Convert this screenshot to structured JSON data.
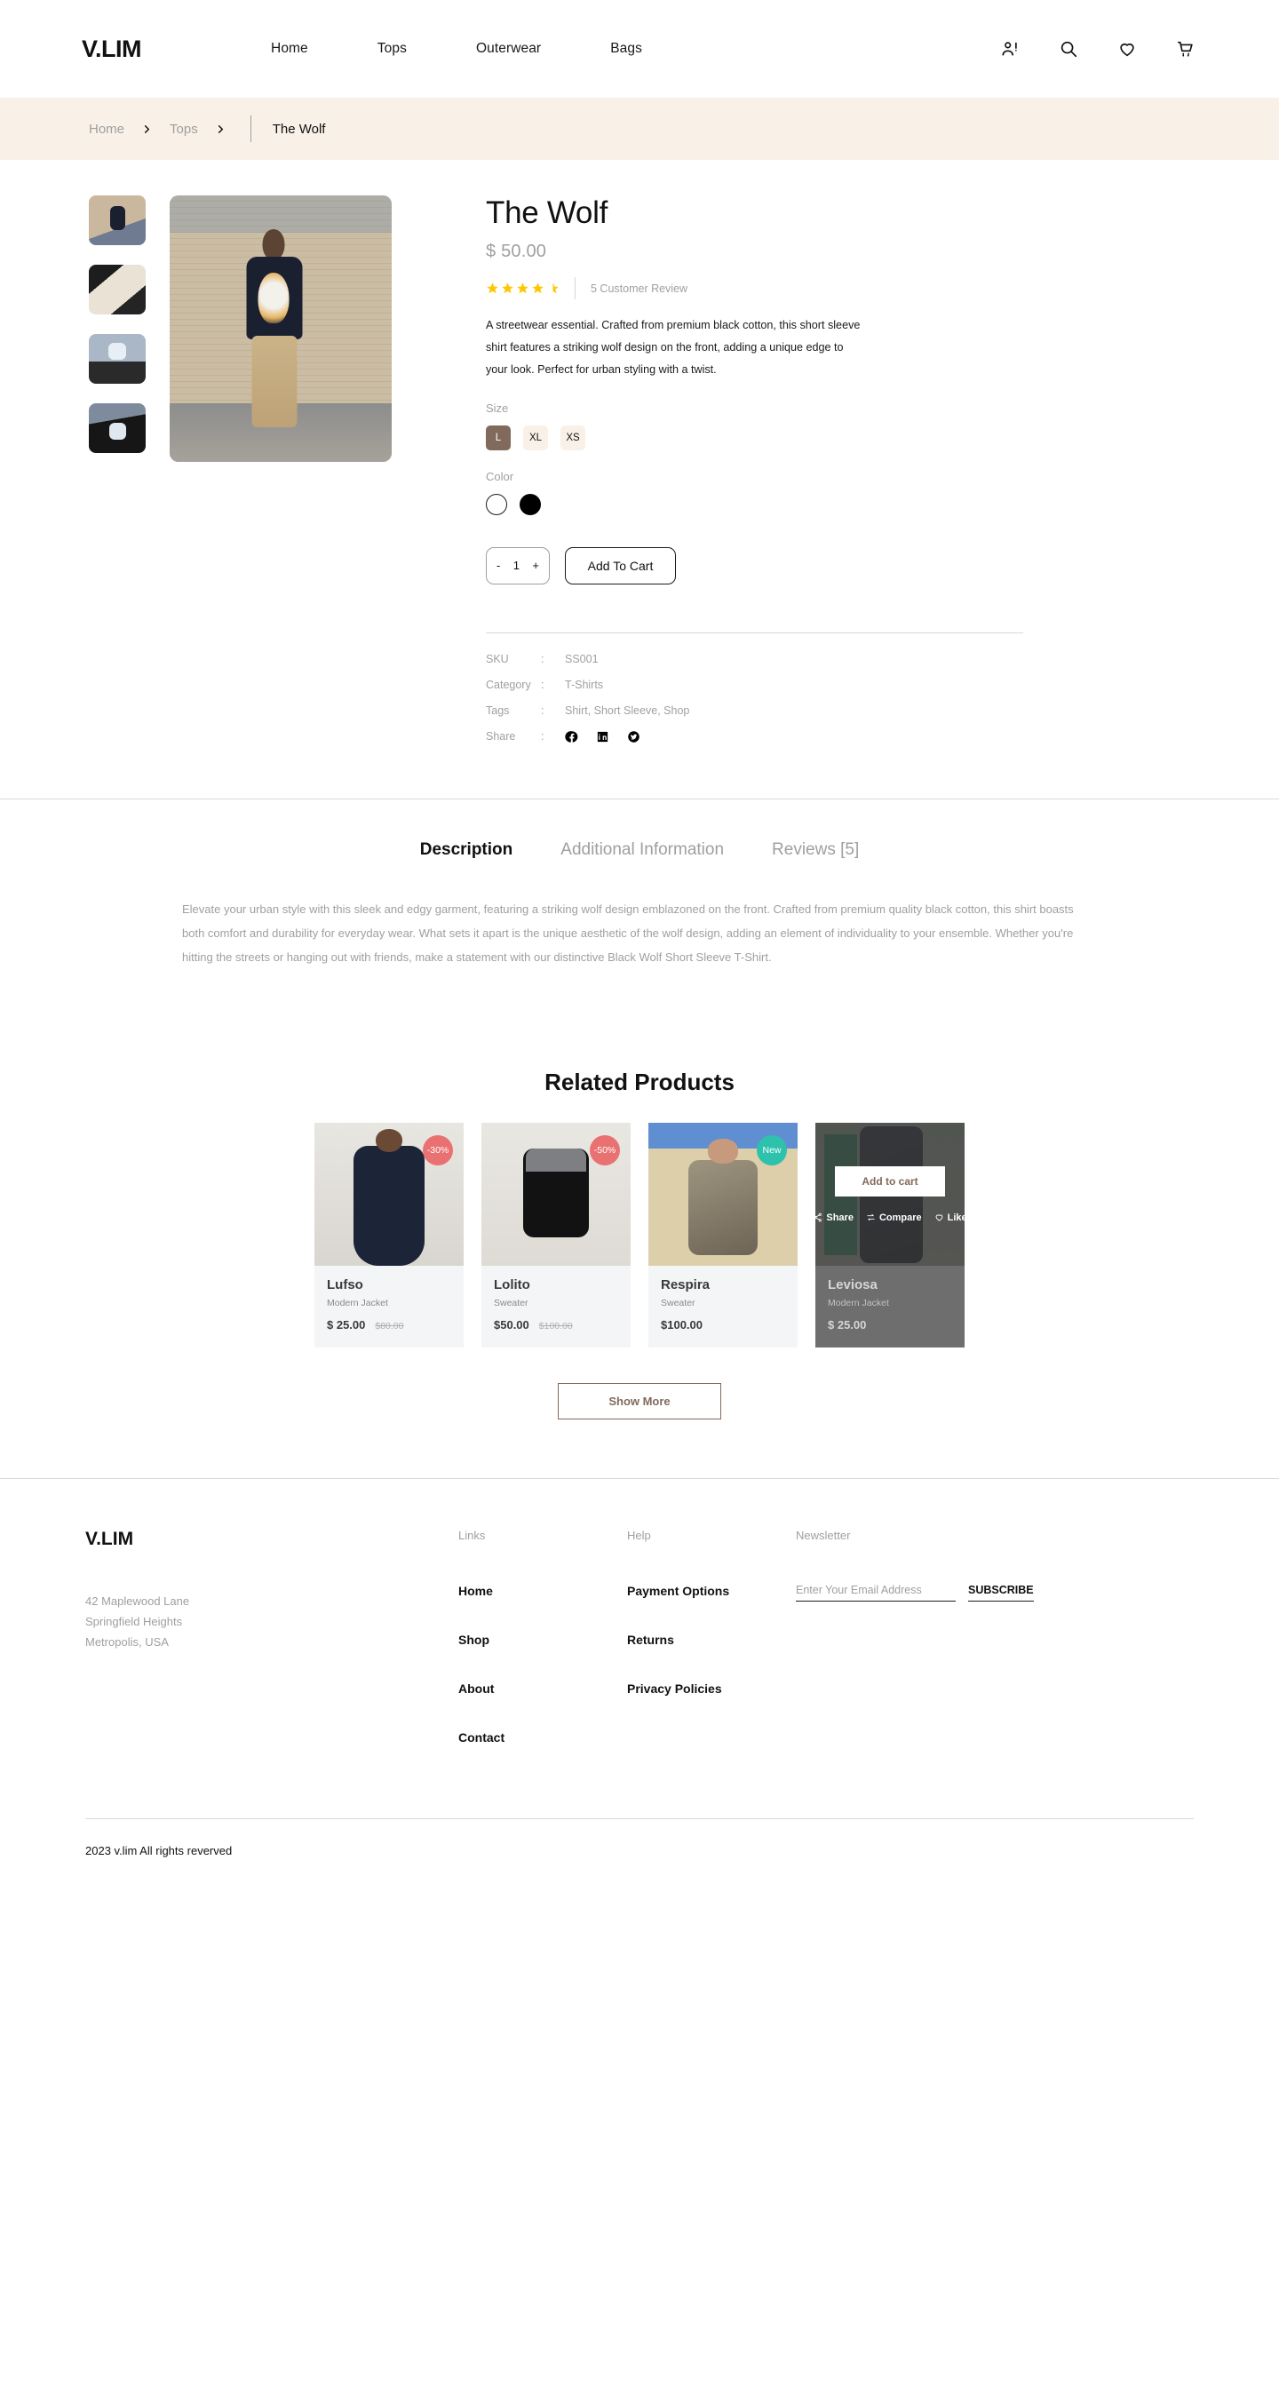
{
  "header": {
    "logo": "V.LIM",
    "nav": [
      {
        "label": "Home"
      },
      {
        "label": "Tops"
      },
      {
        "label": "Outerwear"
      },
      {
        "label": "Bags"
      }
    ],
    "actions": [
      {
        "name": "account-icon",
        "label": "Account"
      },
      {
        "name": "search-icon",
        "label": "Search"
      },
      {
        "name": "wishlist-heart-icon",
        "label": "Wishlist"
      },
      {
        "name": "cart-icon",
        "label": "Cart"
      }
    ]
  },
  "breadcrumb": {
    "items": [
      {
        "label": "Home"
      },
      {
        "label": "Tops"
      }
    ],
    "current": "The Wolf"
  },
  "product": {
    "title": "The Wolf",
    "price": "$ 50.00",
    "rating": 4.5,
    "review_count_label": "5 Customer Review",
    "description": "A streetwear essential. Crafted from premium black cotton, this short sleeve shirt features a striking wolf design on the front, adding a unique edge to your look. Perfect for urban styling with a twist.",
    "size_label": "Size",
    "sizes": [
      {
        "label": "L",
        "selected": true
      },
      {
        "label": "XL",
        "selected": false
      },
      {
        "label": "XS",
        "selected": false
      }
    ],
    "color_label": "Color",
    "colors": [
      {
        "name": "white",
        "hex": "#ffffff",
        "selected": false
      },
      {
        "name": "black",
        "hex": "#000000",
        "selected": true
      }
    ],
    "quantity": "1",
    "qty_minus": "-",
    "qty_plus": "+",
    "add_to_cart_label": "Add To Cart",
    "meta": [
      {
        "key": "SKU",
        "colon": ":",
        "value": "SS001"
      },
      {
        "key": "Category",
        "colon": ":",
        "value": "T-Shirts"
      },
      {
        "key": "Tags",
        "colon": ":",
        "value": "Shirt, Short Sleeve, Shop"
      }
    ],
    "share_key": "Share",
    "share_colon": ":",
    "share_icons": [
      "facebook-icon",
      "linkedin-icon",
      "twitter-icon"
    ],
    "gallery_thumbs": [
      {
        "alt": "model-walking-full-shot"
      },
      {
        "alt": "wolf-graphic-closeup"
      },
      {
        "alt": "model-front-view"
      },
      {
        "alt": "model-side-view"
      }
    ],
    "main_image_alt": "model-wearing-the-wolf-tshirt"
  },
  "tabs": {
    "items": [
      {
        "label": "Description",
        "active": true
      },
      {
        "label": "Additional Information",
        "active": false
      },
      {
        "label": "Reviews [5]",
        "active": false
      }
    ],
    "description_body": "Elevate your urban style with this sleek and edgy garment, featuring a striking wolf design emblazoned on the front. Crafted from premium quality black cotton, this shirt boasts both comfort and durability for everyday wear. What sets it apart is the unique aesthetic of the wolf design, adding an element of individuality to your ensemble. Whether you're hitting the streets or hanging out with friends, make a statement with our distinctive Black Wolf Short Sleeve T-Shirt."
  },
  "related": {
    "title": "Related Products",
    "show_more_label": "Show More",
    "overlay": {
      "add_to_cart": "Add to cart",
      "share": "Share",
      "compare": "Compare",
      "like": "Like"
    },
    "products": [
      {
        "name": "Lufso",
        "subtitle": "Modern Jacket",
        "price": "$ 25.00",
        "old_price": "$80.00",
        "badge": "-30%",
        "badge_type": "sale",
        "hovered": false
      },
      {
        "name": "Lolito",
        "subtitle": "Sweater",
        "price": "$50.00",
        "old_price": "$100.00",
        "badge": "-50%",
        "badge_type": "sale",
        "hovered": false
      },
      {
        "name": "Respira",
        "subtitle": "Sweater",
        "price": "$100.00",
        "old_price": "",
        "badge": "New",
        "badge_type": "new",
        "hovered": false
      },
      {
        "name": "Leviosa",
        "subtitle": "Modern Jacket",
        "price": "$ 25.00",
        "old_price": "",
        "badge": "",
        "badge_type": "",
        "hovered": true
      }
    ]
  },
  "footer": {
    "logo": "V.LIM",
    "address_line1": "42 Maplewood Lane",
    "address_line2": "Springfield Heights",
    "address_line3": "Metropolis, USA",
    "links_head": "Links",
    "links": [
      {
        "label": "Home"
      },
      {
        "label": "Shop"
      },
      {
        "label": "About"
      },
      {
        "label": "Contact"
      }
    ],
    "help_head": "Help",
    "help": [
      {
        "label": "Payment Options"
      },
      {
        "label": "Returns"
      },
      {
        "label": "Privacy Policies"
      }
    ],
    "newsletter_head": "Newsletter",
    "email_placeholder": "Enter Your Email Address",
    "email_value": "",
    "subscribe_label": "SUBSCRIBE",
    "copyright": "2023 v.lim All rights reverved"
  },
  "colors": {
    "accent_brown": "#816a5b",
    "breadcrumb_bg": "#f9f1e7",
    "sale_badge": "#e97171",
    "new_badge": "#2ec1ac",
    "star_gold": "#ffc700",
    "muted_text": "#9f9f9f"
  }
}
